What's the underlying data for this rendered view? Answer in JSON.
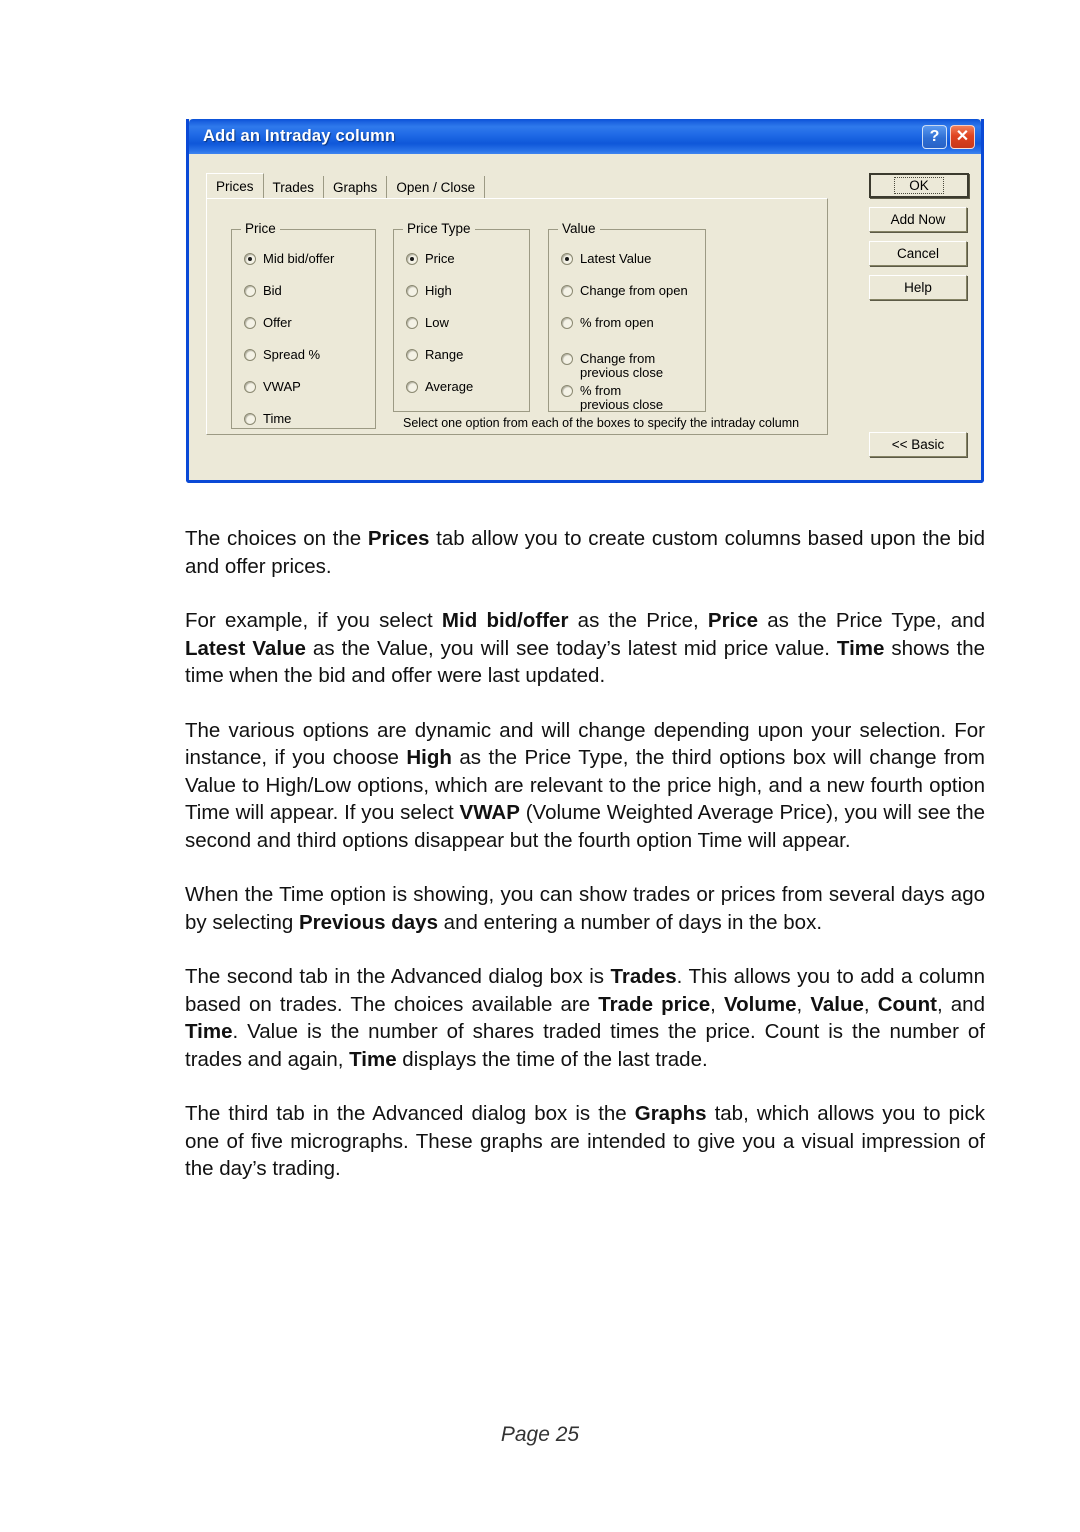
{
  "dialog": {
    "title": "Add an Intraday column",
    "titlebar_buttons": [
      {
        "name": "help-button",
        "glyph": "?"
      },
      {
        "name": "close-button",
        "glyph": "✕"
      }
    ],
    "accent_color": "#0a51d8",
    "face_color": "#ece9d8",
    "tabs": [
      {
        "label": "Prices",
        "selected": true
      },
      {
        "label": "Trades",
        "selected": false
      },
      {
        "label": "Graphs",
        "selected": false
      },
      {
        "label": "Open / Close",
        "selected": false
      }
    ],
    "groups": [
      {
        "legend": "Price",
        "options": [
          {
            "label": "Mid bid/offer",
            "checked": true
          },
          {
            "label": "Bid",
            "checked": false
          },
          {
            "label": "Offer",
            "checked": false
          },
          {
            "label": "Spread %",
            "checked": false
          },
          {
            "label": "VWAP",
            "checked": false
          },
          {
            "label": "Time",
            "checked": false
          }
        ]
      },
      {
        "legend": "Price Type",
        "options": [
          {
            "label": "Price",
            "checked": true
          },
          {
            "label": "High",
            "checked": false
          },
          {
            "label": "Low",
            "checked": false
          },
          {
            "label": "Range",
            "checked": false
          },
          {
            "label": "Average",
            "checked": false
          }
        ]
      },
      {
        "legend": "Value",
        "options": [
          {
            "label": "Latest Value",
            "checked": true
          },
          {
            "label": "Change from open",
            "checked": false
          },
          {
            "label": "% from open",
            "checked": false
          },
          {
            "label_line1": "Change from",
            "label_line2": "previous close",
            "checked": false
          },
          {
            "label_line1": "% from",
            "label_line2": "previous close",
            "checked": false
          }
        ]
      }
    ],
    "hint": "Select one option from each of the boxes to specify the intraday column",
    "buttons": {
      "ok": "OK",
      "add_now": "Add Now",
      "cancel": "Cancel",
      "help": "Help",
      "basic": "<< Basic"
    }
  },
  "paragraphs": [
    {
      "id": "p1",
      "runs": [
        {
          "t": "The choices on the "
        },
        {
          "t": "Prices",
          "b": true
        },
        {
          "t": " tab allow you to create custom columns based upon the bid and offer prices."
        }
      ]
    },
    {
      "id": "p2",
      "runs": [
        {
          "t": "For example, if you select "
        },
        {
          "t": "Mid bid/offer",
          "b": true
        },
        {
          "t": " as the Price, "
        },
        {
          "t": "Price",
          "b": true
        },
        {
          "t": " as the Price Type, and "
        },
        {
          "t": "Latest Value",
          "b": true
        },
        {
          "t": " as the Value, you will see today’s latest mid price value. "
        },
        {
          "t": "Time",
          "b": true
        },
        {
          "t": " shows the time when the bid and offer were last updated."
        }
      ]
    },
    {
      "id": "p3",
      "runs": [
        {
          "t": "The various options are dynamic and will change depending upon your selection. For instance, if you choose "
        },
        {
          "t": "High",
          "b": true
        },
        {
          "t": " as the Price Type, the third options box will change from Value to High/Low options, which are relevant to the price high, and a new fourth option Time will appear. If you select "
        },
        {
          "t": "VWAP",
          "b": true
        },
        {
          "t": " (Volume Weighted Average Price), you will see the second and third options disappear but the fourth option Time will appear."
        }
      ]
    },
    {
      "id": "p4",
      "runs": [
        {
          "t": "When the Time option is showing, you can show trades or prices from several days ago by selecting "
        },
        {
          "t": "Previous days",
          "b": true
        },
        {
          "t": " and entering a number of days in the box."
        }
      ]
    },
    {
      "id": "p5",
      "runs": [
        {
          "t": "The second tab in the Advanced dialog box is "
        },
        {
          "t": "Trades",
          "b": true
        },
        {
          "t": ".  This allows you to add a column based on trades. The choices available are "
        },
        {
          "t": "Trade price",
          "b": true
        },
        {
          "t": ", "
        },
        {
          "t": "Volume",
          "b": true
        },
        {
          "t": ", "
        },
        {
          "t": "Value",
          "b": true
        },
        {
          "t": ", "
        },
        {
          "t": "Count",
          "b": true
        },
        {
          "t": ", and "
        },
        {
          "t": "Time",
          "b": true
        },
        {
          "t": ". Value is the number of shares traded times the price. Count is the number of trades and again, "
        },
        {
          "t": "Time",
          "b": true
        },
        {
          "t": " displays the time of the last trade."
        }
      ]
    },
    {
      "id": "p6",
      "runs": [
        {
          "t": "The third tab in the Advanced dialog box is the "
        },
        {
          "t": "Graphs",
          "b": true
        },
        {
          "t": " tab, which allows you to pick one of five micrographs. These graphs are intended to give you a visual impression of the day’s trading."
        }
      ]
    }
  ],
  "footer": {
    "page_label": "Page 25"
  }
}
